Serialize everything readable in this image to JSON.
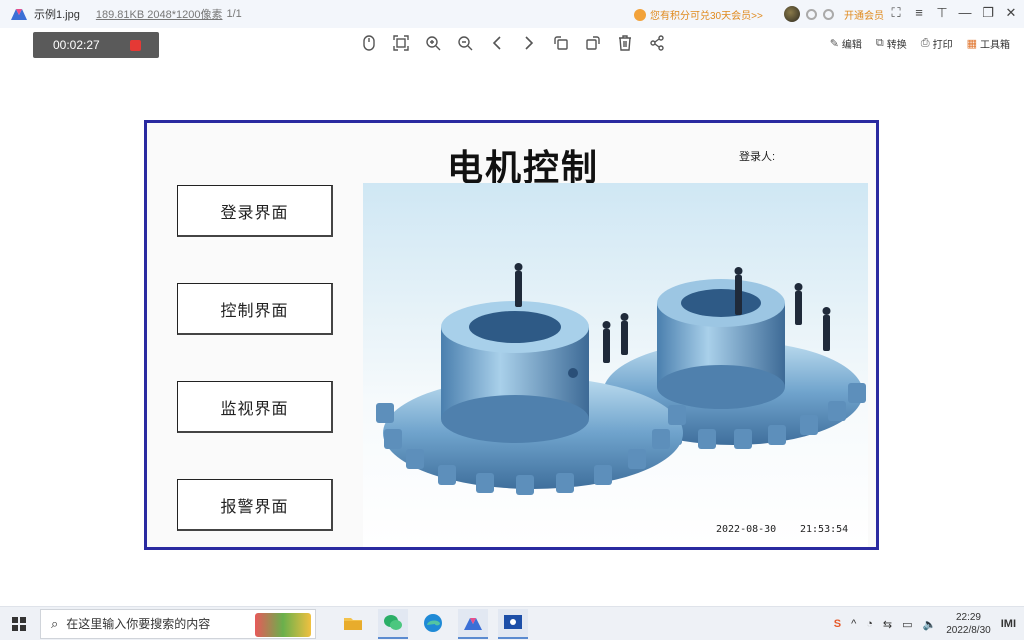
{
  "viewer": {
    "file_name": "示例1.jpg",
    "file_meta": "189.81KB  2048*1200像素",
    "page_indicator": "1/1",
    "promo_text": "您有积分可兑30天会员>>",
    "vip_label": "开通会员",
    "toolbar_right": {
      "edit": "编辑",
      "convert": "转换",
      "print": "打印",
      "toolbox": "工具箱"
    }
  },
  "recorder": {
    "time": "00:02:27"
  },
  "hmi": {
    "title": "电机控制",
    "login_person_label": "登录人:",
    "nav": [
      {
        "label": "登录界面"
      },
      {
        "label": "控制界面"
      },
      {
        "label": "监视界面"
      },
      {
        "label": "报警界面"
      }
    ],
    "date": "2022-08-30",
    "time": "21:53:54"
  },
  "taskbar": {
    "search_placeholder": "在这里输入你要搜索的内容",
    "clock_time": "22:29",
    "clock_date": "2022/8/30"
  },
  "colors": {
    "frame_border": "#2a2aa0",
    "gear_metal": "#7fb0d6",
    "record_dot": "#e53935"
  }
}
